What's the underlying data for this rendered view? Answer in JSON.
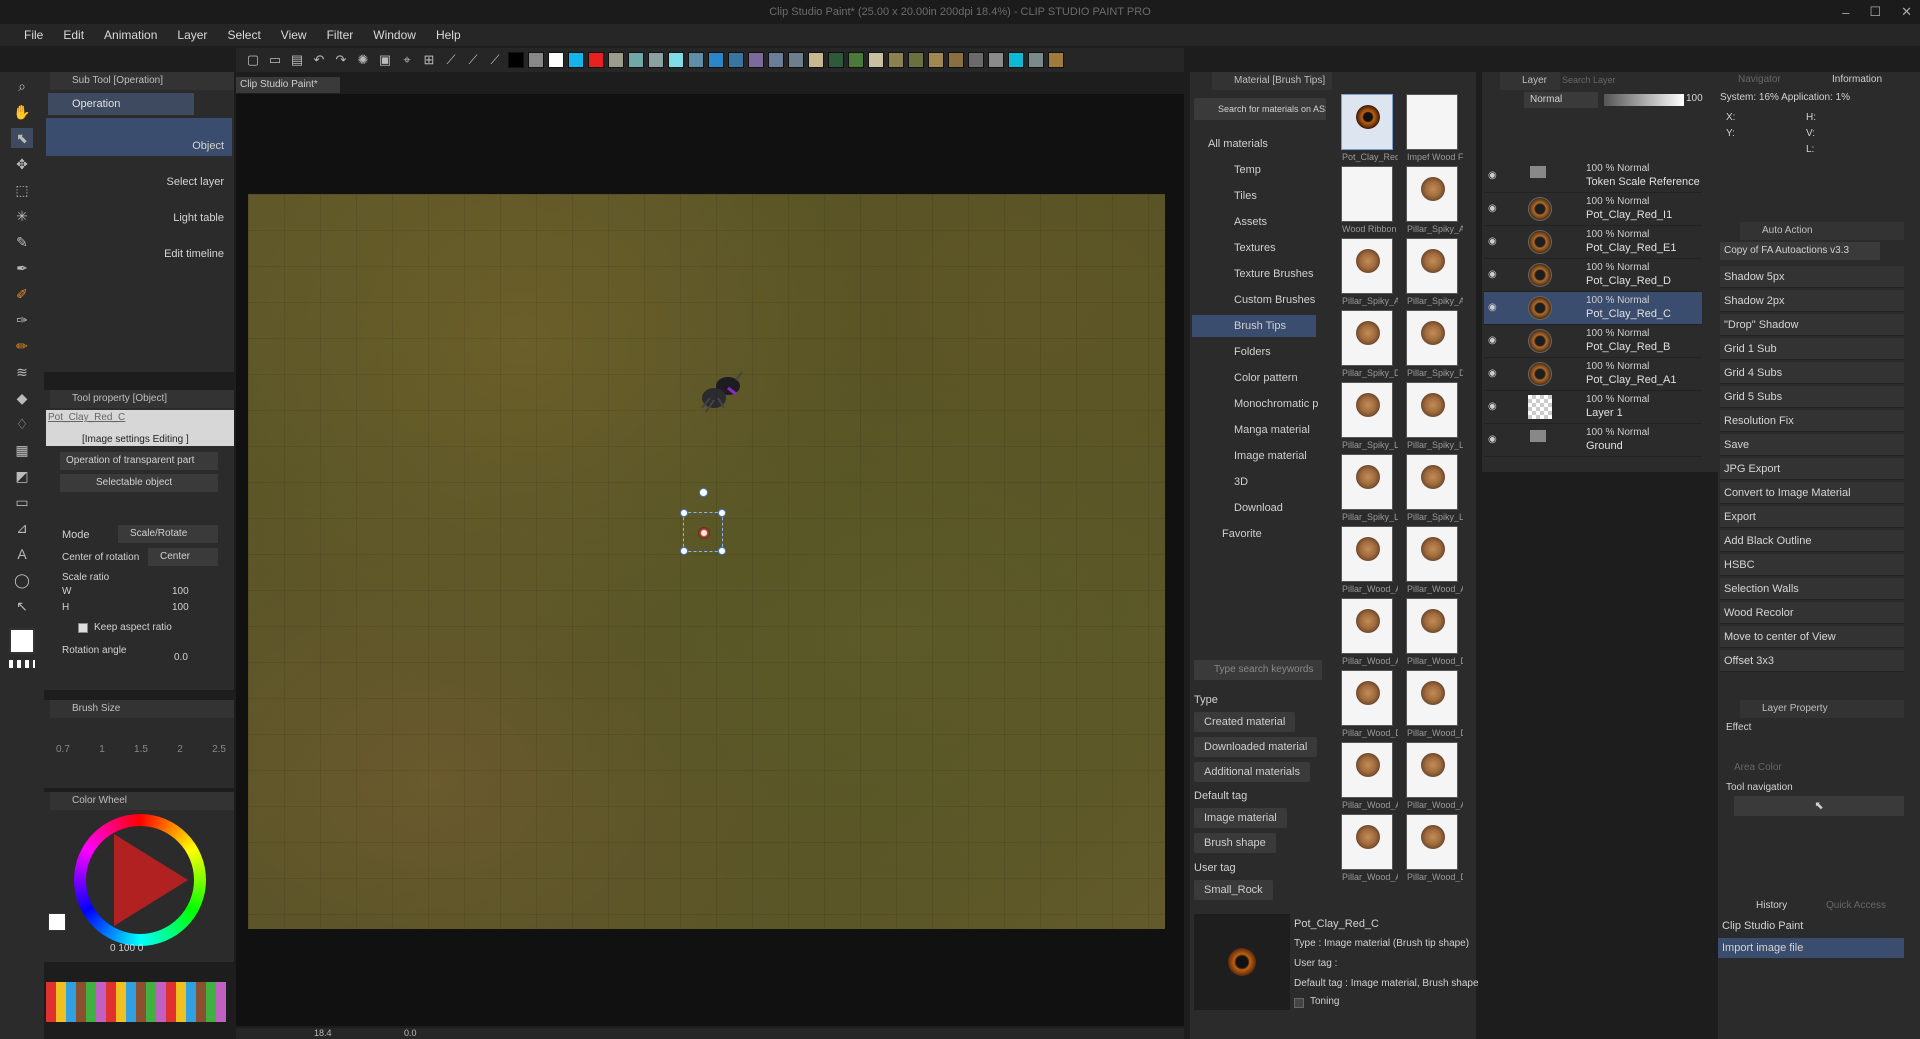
{
  "title": "Clip Studio Paint* (25.00 x 20.00in 200dpi 18.4%) - CLIP STUDIO PAINT PRO",
  "menu": [
    "File",
    "Edit",
    "Animation",
    "Layer",
    "Select",
    "View",
    "Filter",
    "Window",
    "Help"
  ],
  "subtool": {
    "header": "Sub Tool [Operation]",
    "active": "Operation",
    "items": [
      "Object",
      "Select layer",
      "Light table",
      "Edit timeline"
    ]
  },
  "toolprop": {
    "header": "Tool property [Object]",
    "object_name": "Pot_Clay_Red_C",
    "image_settings": "[Image settings Editing ]",
    "transparent": "Operation of transparent part",
    "selectable": "Selectable object",
    "mode_label": "Mode",
    "mode_value": "Scale/Rotate",
    "center_label": "Center of rotation",
    "center_value": "Center",
    "scale_label": "Scale ratio",
    "w_label": "W",
    "w_value": "100",
    "h_label": "H",
    "h_value": "100",
    "keep_aspect": "Keep aspect ratio",
    "rotation_label": "Rotation angle",
    "rotation_value": "0.0"
  },
  "brushsize": {
    "header": "Brush Size",
    "values": [
      "0.7",
      "1",
      "1.5",
      "2",
      "2.5"
    ]
  },
  "colorwheel": {
    "header": "Color Wheel",
    "values": "0  100  0"
  },
  "doc_tab": "Clip Studio Paint*",
  "statusbar": {
    "zoom": "18.4",
    "angle": "0.0"
  },
  "material": {
    "header": "Material [Brush Tips]",
    "search_assets": "Search for materials on ASSETS",
    "tree": [
      "All materials",
      "Temp",
      "Tiles",
      "Assets",
      "Textures",
      "Texture Brushes",
      "Custom Brushes",
      "Brush Tips",
      "Folders",
      "Color pattern",
      "Monochromatic p",
      "Manga material",
      "Image material",
      "3D",
      "Download",
      "Favorite"
    ],
    "thumbs": [
      "Pot_Clay_Red",
      "Impef Wood F",
      "Wood Ribbon",
      "Pillar_Spiky_A",
      "Pillar_Spiky_A",
      "Pillar_Spiky_A",
      "Pillar_Spiky_D",
      "Pillar_Spiky_D",
      "Pillar_Spiky_Li",
      "Pillar_Spiky_Li",
      "Pillar_Spiky_Li",
      "Pillar_Spiky_Li",
      "Pillar_Wood_A",
      "Pillar_Wood_A",
      "Pillar_Wood_A",
      "Pillar_Wood_D",
      "Pillar_Wood_D",
      "Pillar_Wood_D",
      "Pillar_Wood_A",
      "Pillar_Wood_A",
      "Pillar_Wood_A",
      "Pillar_Wood_D"
    ],
    "search_placeholder": "Type search keywords",
    "type_label": "Type",
    "type_btns": [
      "Created material",
      "Downloaded material",
      "Additional materials"
    ],
    "default_tag": "Default tag",
    "default_btns": [
      "Image material",
      "Brush shape"
    ],
    "user_tag": "User tag",
    "user_btns": [
      "Small_Rock"
    ],
    "detail_name": "Pot_Clay_Red_C",
    "detail_type": "Type : Image material (Brush tip shape)",
    "detail_usertag": "User tag :",
    "detail_default": "Default tag : Image material, Brush shape",
    "detail_toning": "Toning"
  },
  "layer": {
    "header": "Layer",
    "search": "Search Layer",
    "blend": "Normal",
    "opacity": "100",
    "rows": [
      {
        "pct": "100 % Normal",
        "name": "Token Scale Reference",
        "folder": true
      },
      {
        "pct": "100 % Normal",
        "name": "Pot_Clay_Red_I1"
      },
      {
        "pct": "100 % Normal",
        "name": "Pot_Clay_Red_E1"
      },
      {
        "pct": "100 % Normal",
        "name": "Pot_Clay_Red_D"
      },
      {
        "pct": "100 % Normal",
        "name": "Pot_Clay_Red_C",
        "selected": true
      },
      {
        "pct": "100 % Normal",
        "name": "Pot_Clay_Red_B"
      },
      {
        "pct": "100 % Normal",
        "name": "Pot_Clay_Red_A1"
      },
      {
        "pct": "100 % Normal",
        "name": "Layer 1"
      },
      {
        "pct": "100 % Normal",
        "name": "Ground",
        "folder": true
      }
    ]
  },
  "navigator": {
    "tab1": "Navigator",
    "tab2": "Information",
    "system": "System: 16%  Application: 1%",
    "x": "X:",
    "y": "Y:",
    "h": "H:",
    "v": "V:",
    "l": "L:"
  },
  "autoaction": {
    "header": "Auto Action",
    "set": "Copy of FA Autoactions v3.3",
    "items": [
      "Shadow 5px",
      "Shadow 2px",
      "\"Drop\" Shadow",
      "Grid 1 Sub",
      "Grid 4 Subs",
      "Grid 5 Subs",
      "Resolution Fix",
      "Save",
      "JPG Export",
      "Convert to Image Material",
      "Export",
      "Add Black Outline",
      "HSBC",
      "Selection Walls",
      "Wood Recolor",
      "Move to center of View",
      "Offset 3x3"
    ]
  },
  "layerprop": {
    "header": "Layer Property",
    "effect": "Effect",
    "area_color": "Area Color",
    "tool_nav": "Tool navigation"
  },
  "history": {
    "tab1": "History",
    "tab2": "Quick Access",
    "items": [
      "Clip Studio Paint",
      "Import image file"
    ]
  },
  "colors": {
    "accent": "#3e4a60",
    "selected": "#3a4d6e",
    "panel": "#2b2b2b"
  }
}
